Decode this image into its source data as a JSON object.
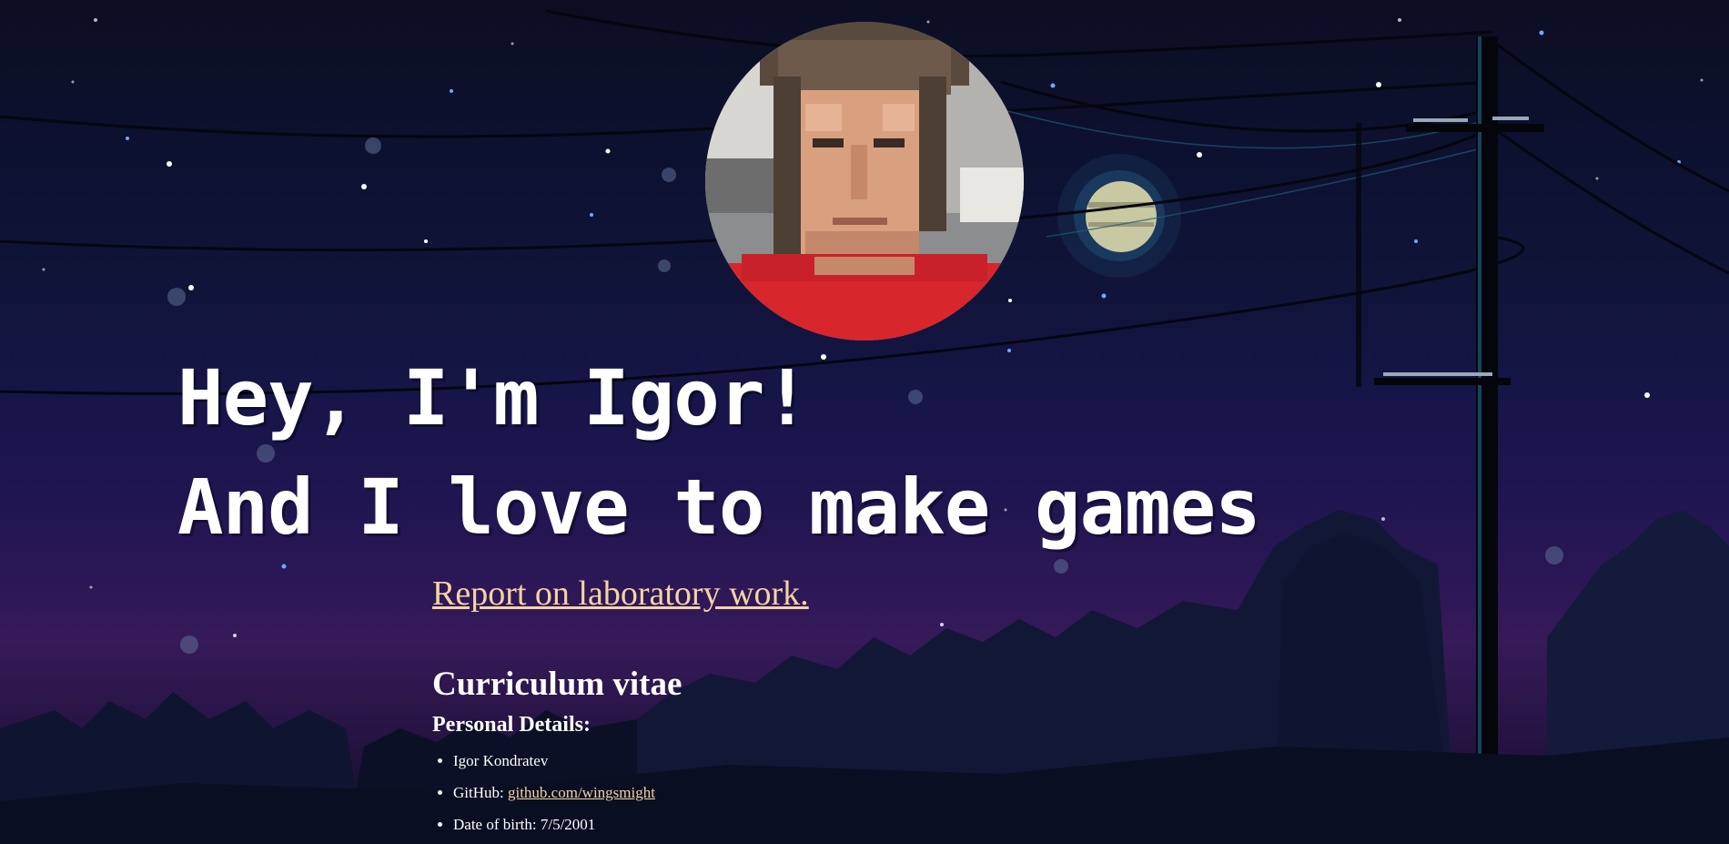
{
  "profile": {
    "avatar_alt": "Pixel-art portrait of Igor"
  },
  "hero": {
    "line1": "Hey, I'm Igor!",
    "line2": "And I love to make games"
  },
  "report_link": {
    "label": "Report on laboratory work."
  },
  "cv": {
    "title": "Curriculum vitae",
    "personal_details_label": "Personal Details:",
    "name": "Igor Kondratev",
    "github_label": "GitHub: ",
    "github_link": "github.com/wingsmight",
    "dob_label": "Date of birth: ",
    "dob_value": "7/5/2001"
  },
  "colors": {
    "link": "#f4d3a4",
    "text": "#ffffff",
    "sky_top": "#0b0e22",
    "sky_horizon": "#361a5a",
    "shirt": "#d8262d"
  },
  "icons": {
    "moon": "moon-icon",
    "power_pole": "power-pole"
  }
}
